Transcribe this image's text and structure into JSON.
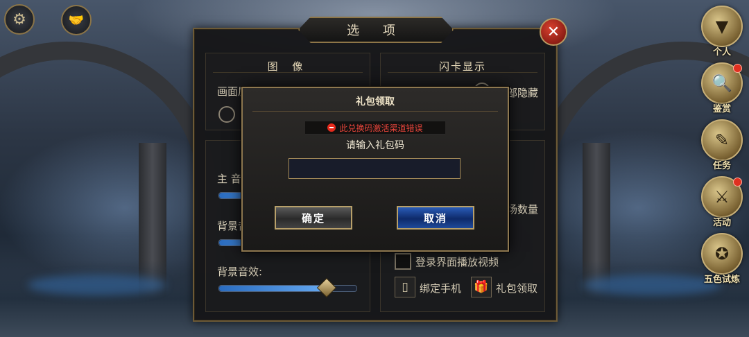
{
  "top_left": {
    "settings_icon": "gear-icon",
    "social_icon": "handshake-icon"
  },
  "side_menu": [
    {
      "label": "个人",
      "icon": "triangle-gem-icon",
      "badge": false
    },
    {
      "label": "鉴赏",
      "icon": "magnifier-scroll-icon",
      "badge": true
    },
    {
      "label": "任务",
      "icon": "quill-scroll-icon",
      "badge": false
    },
    {
      "label": "活动",
      "icon": "shield-swords-icon",
      "badge": true
    },
    {
      "label": "五色试炼",
      "icon": "five-gem-emblem-icon",
      "badge": false
    }
  ],
  "options": {
    "title": "选 项",
    "close_icon": "close-icon",
    "image_section": {
      "title": "图 像",
      "quality_label": "画面质量"
    },
    "flash_section": {
      "title": "闪卡显示",
      "hide_all_label": "部隐藏"
    },
    "audio_section": {
      "main_label": "主 音",
      "bgm_label": "背景音",
      "sfx_label": "背景音效:",
      "sfx_level": 0.78
    },
    "misc_section": {
      "field_count_label": "场数量",
      "login_video_label": "登录界面播放视频",
      "bind_phone_label": "绑定手机",
      "gift_claim_label": "礼包领取"
    }
  },
  "modal": {
    "title": "礼包领取",
    "error": "此兑换码激活渠道错误",
    "prompt": "请输入礼包码",
    "input_value": "",
    "confirm_label": "确定",
    "cancel_label": "取消"
  }
}
